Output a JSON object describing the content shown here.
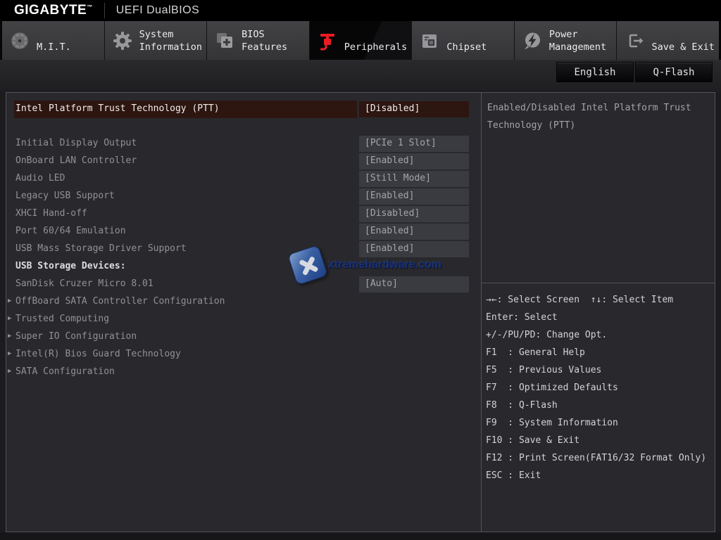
{
  "header": {
    "brand": "GIGABYTE",
    "brand_tm": "™",
    "title": "UEFI DualBIOS"
  },
  "toolbar": {
    "language_button": "English",
    "qflash_button": "Q-Flash"
  },
  "tabs": [
    {
      "line1": "M.I.T.",
      "line2": ""
    },
    {
      "line1": "System",
      "line2": "Information"
    },
    {
      "line1": "BIOS",
      "line2": "Features"
    },
    {
      "line1": "Peripherals",
      "line2": ""
    },
    {
      "line1": "Chipset",
      "line2": ""
    },
    {
      "line1": "Power",
      "line2": "Management"
    },
    {
      "line1": "Save & Exit",
      "line2": ""
    }
  ],
  "settings": {
    "submenu_marker": "▶",
    "rows": [
      {
        "label": "Intel Platform Trust Technology (PTT)",
        "value": "[Disabled]"
      },
      {
        "label": "Initial Display Output",
        "value": "[PCIe 1 Slot]"
      },
      {
        "label": "OnBoard LAN Controller",
        "value": "[Enabled]"
      },
      {
        "label": "Audio LED",
        "value": "[Still Mode]"
      },
      {
        "label": "Legacy USB Support",
        "value": "[Enabled]"
      },
      {
        "label": "XHCI Hand-off",
        "value": "[Disabled]"
      },
      {
        "label": "Port 60/64 Emulation",
        "value": "[Enabled]"
      },
      {
        "label": "USB Mass Storage Driver Support",
        "value": "[Enabled]"
      },
      {
        "label": "USB Storage Devices:",
        "value": ""
      },
      {
        "label": "SanDisk Cruzer Micro 8.01",
        "value": "[Auto]"
      },
      {
        "label": "OffBoard SATA Controller Configuration",
        "value": ""
      },
      {
        "label": "Trusted Computing",
        "value": ""
      },
      {
        "label": "Super IO Configuration",
        "value": ""
      },
      {
        "label": "Intel(R) Bios Guard Technology",
        "value": ""
      },
      {
        "label": "SATA Configuration",
        "value": ""
      }
    ]
  },
  "help": {
    "text": "Enabled/Disabled Intel Platform Trust Technology (PTT)"
  },
  "legend": {
    "lines": [
      "→←: Select Screen  ↑↓: Select Item",
      "Enter: Select",
      "+/-/PU/PD: Change Opt.",
      "F1  : General Help",
      "F5  : Previous Values",
      "F7  : Optimized Defaults",
      "F8  : Q-Flash",
      "F9  : System Information",
      "F10 : Save & Exit",
      "F12 : Print Screen(FAT16/32 Format Only)",
      "ESC : Exit"
    ]
  },
  "watermark": {
    "text": "xtremehardware.com"
  },
  "colors": {
    "accent_red": "#ed1c24",
    "selected_bg": "#2d1510",
    "value_bg": "#3a3b40",
    "content_bg": "#29292d"
  }
}
